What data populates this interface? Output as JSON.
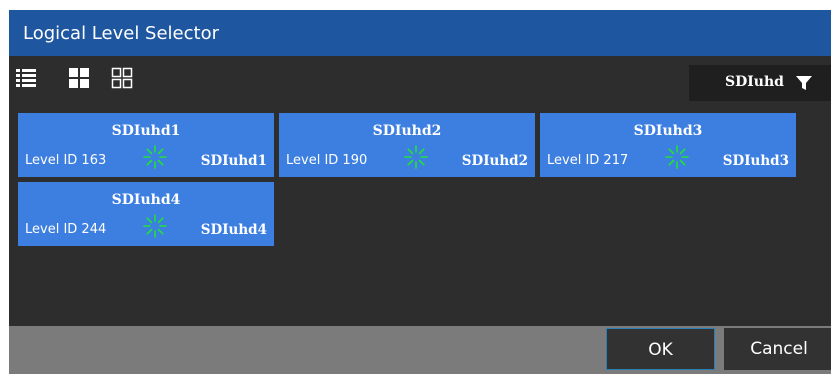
{
  "dialog": {
    "title": "Logical Level Selector"
  },
  "toolbar": {
    "icons": [
      "list-view-icon",
      "large-tile-view-icon",
      "small-tile-view-icon"
    ],
    "filter": {
      "value": "SDIuhd",
      "icon": "filter-funnel-icon"
    }
  },
  "levels": [
    {
      "name": "SDIuhd1",
      "level": "Level ID 163",
      "tag": "SDIuhd1",
      "status_icon": "spinner-icon"
    },
    {
      "name": "SDIuhd2",
      "level": "Level ID 190",
      "tag": "SDIuhd2",
      "status_icon": "spinner-icon"
    },
    {
      "name": "SDIuhd3",
      "level": "Level ID 217",
      "tag": "SDIuhd3",
      "status_icon": "spinner-icon"
    },
    {
      "name": "SDIuhd4",
      "level": "Level ID 244",
      "tag": "SDIuhd4",
      "status_icon": "spinner-icon"
    }
  ],
  "footer": {
    "ok_label": "OK",
    "cancel_label": "Cancel"
  },
  "colors": {
    "title_bar": "#1e56a0",
    "card": "#3d7fe0",
    "spinner": "#22e03a",
    "background": "#2d2d2d",
    "footer": "#7b7b7b"
  }
}
